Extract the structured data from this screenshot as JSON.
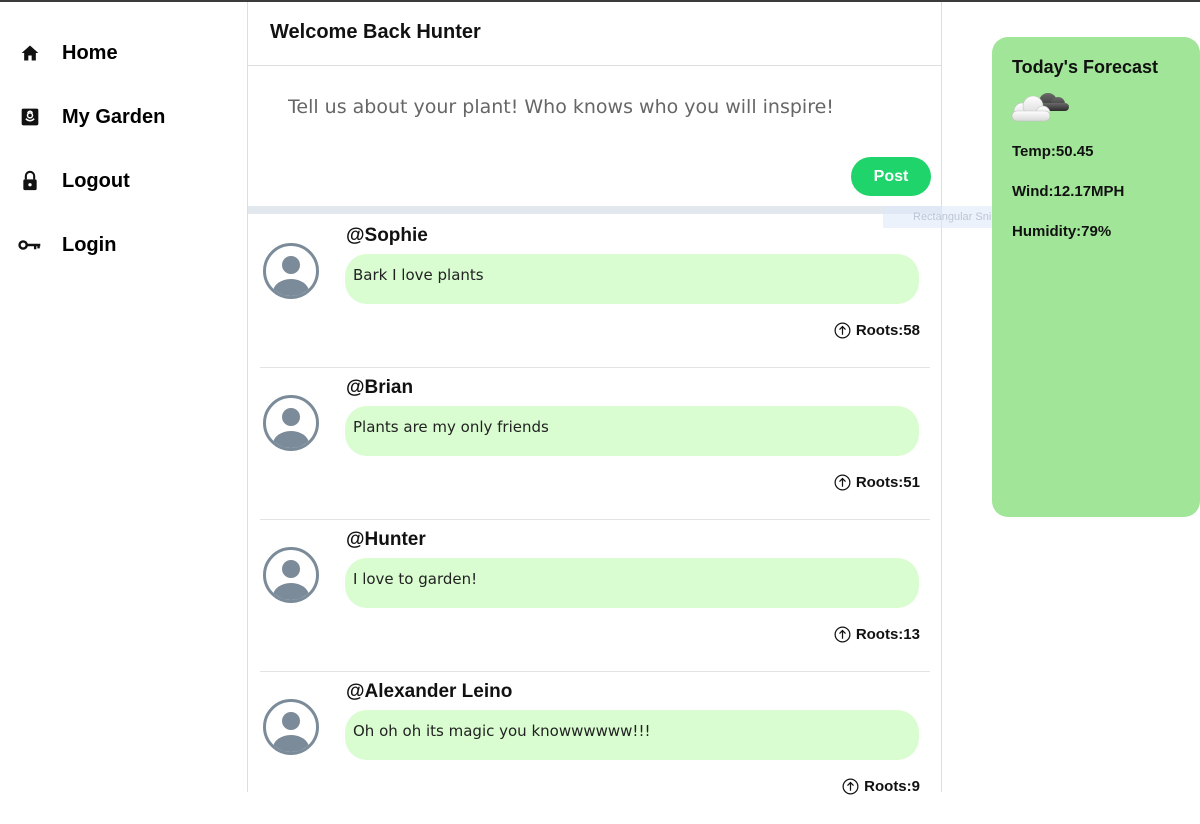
{
  "sidebar": {
    "items": [
      {
        "label": "Home",
        "icon": "home-icon"
      },
      {
        "label": "My Garden",
        "icon": "garden-icon"
      },
      {
        "label": "Logout",
        "icon": "lock-icon"
      },
      {
        "label": "Login",
        "icon": "key-icon"
      }
    ]
  },
  "feed": {
    "title": "Welcome Back Hunter",
    "compose_placeholder": "Tell us about your plant! Who knows who you will inspire!",
    "post_button": "Post",
    "snip_ghost": "Rectangular Snip",
    "posts": [
      {
        "username": "@Sophie",
        "text": "Bark I love plants",
        "roots": "Roots:58"
      },
      {
        "username": "@Brian",
        "text": "Plants are my only friends",
        "roots": "Roots:51"
      },
      {
        "username": "@Hunter",
        "text": "I love to garden!",
        "roots": "Roots:13"
      },
      {
        "username": "@Alexander Leino",
        "text": "Oh oh oh its magic you knowwwwww!!!",
        "roots": "Roots:9"
      }
    ]
  },
  "weather": {
    "title": "Today's Forecast",
    "icon": "cloud-icon",
    "temp": "Temp:50.45",
    "wind": "Wind:12.17MPH",
    "humidity": "Humidity:79%"
  },
  "colors": {
    "accent_post": "#1fd46a",
    "bubble": "#d9fdd0",
    "weather_card": "#a1e598",
    "avatar": "#7b8b99"
  }
}
